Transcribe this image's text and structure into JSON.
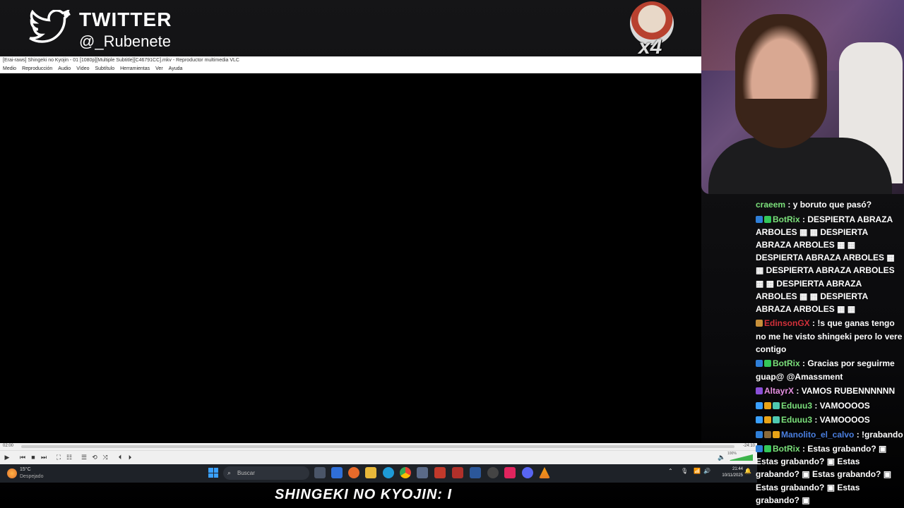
{
  "overlay": {
    "twitter_title": "TWITTER",
    "twitter_handle": "@_Rubenete",
    "multiplier": "x4"
  },
  "vlc": {
    "title": "[Erai-raws] Shingeki no Kyojin - 01 [1080p][Multiple Subtitle][C46791CC].mkv - Reproductor multimedia VLC",
    "menu": [
      "Medio",
      "Reproducción",
      "Audio",
      "Vídeo",
      "Subtítulo",
      "Herramientas",
      "Ver",
      "Ayuda"
    ],
    "time_elapsed": "02:00",
    "time_remaining": "-24:10",
    "volume": "100%"
  },
  "taskbar": {
    "weather_temp": "15°C",
    "weather_cond": "Despejado",
    "search_placeholder": "Buscar",
    "time": "21:44",
    "date": "10/11/2025"
  },
  "subtitle": "SHINGEKI NO KYOJIN: I",
  "chat": [
    {
      "user": "craeem",
      "color": "#7be07b",
      "badges": [],
      "text": ": y boruto que pasó?"
    },
    {
      "user": "BotRix",
      "color": "#7be07b",
      "badges": [
        "#2f7fd8",
        "#34c759"
      ],
      "text": ": DESPIERTA ABRAZA ARBOLES ▦ ▦ DESPIERTA ABRAZA ARBOLES ▦ ▦ DESPIERTA ABRAZA ARBOLES ▦ ▦ DESPIERTA ABRAZA ARBOLES ▦ ▦ DESPIERTA ABRAZA ARBOLES ▦ ▦ DESPIERTA ABRAZA ARBOLES ▦ ▦"
    },
    {
      "user": "EdinsonGX",
      "color": "#d2303a",
      "badges": [
        "#c8903a"
      ],
      "text": ": !s que ganas tengo no me he visto shingeki pero lo vere contigo"
    },
    {
      "user": "BotRix",
      "color": "#7be07b",
      "badges": [
        "#2f7fd8",
        "#34c759"
      ],
      "text": ": Gracias por seguirme guap@ @Amassment"
    },
    {
      "user": "AltayrX",
      "color": "#e58fe0",
      "badges": [
        "#8a4fd8"
      ],
      "text": ": VAMOS RUBENNNNNN"
    },
    {
      "user": "Eduuu3",
      "color": "#7be07b",
      "badges": [
        "#3aa0ff",
        "#e8a317",
        "#4ec9b0"
      ],
      "text": ": VAMOOOOS"
    },
    {
      "user": "Eduuu3",
      "color": "#7be07b",
      "badges": [
        "#3aa0ff",
        "#e8a317",
        "#4ec9b0"
      ],
      "text": ": VAMOOOOS"
    },
    {
      "user": "Manolito_el_calvo",
      "color": "#4a7fe0",
      "badges": [
        "#2f7fd8",
        "#8a6a3a",
        "#e8a317"
      ],
      "text": ": !grabando"
    },
    {
      "user": "BotRix",
      "color": "#7be07b",
      "badges": [
        "#2f7fd8",
        "#34c759"
      ],
      "text": ": Estas grabando? ▣ Estas grabando? ▣ Estas grabando? ▣ Estas grabando? ▣ Estas grabando? ▣ Estas grabando? ▣"
    }
  ]
}
